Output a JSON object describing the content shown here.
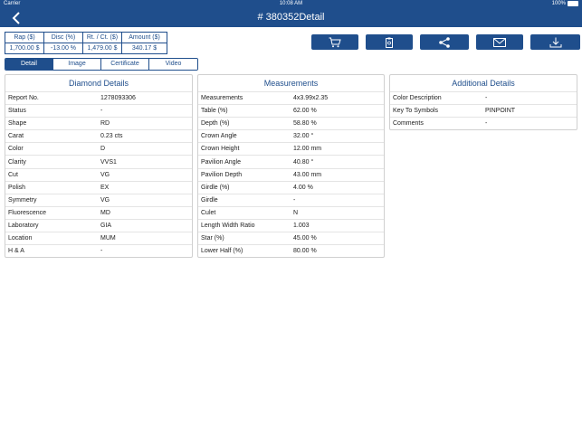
{
  "status_bar": {
    "carrier": "Carrier",
    "time": "10:08 AM",
    "battery": "100%"
  },
  "nav": {
    "title": "# 380352Detail"
  },
  "price": {
    "headers": [
      "Rap ($)",
      "Disc (%)",
      "Rt. / Ct. ($)",
      "Amount ($)"
    ],
    "values": [
      "1,700.00 $",
      "-13.00 %",
      "1,479.00 $",
      "340.17 $"
    ]
  },
  "actions": [
    "cart-icon",
    "clipboard-icon",
    "share-icon",
    "mail-icon",
    "download-icon"
  ],
  "tabs": [
    "Detail",
    "Image",
    "Certificate",
    "Video"
  ],
  "active_tab": "Detail",
  "diamond_details": {
    "title": "Diamond Details",
    "rows": [
      {
        "k": "Report No.",
        "v": "1278093306"
      },
      {
        "k": "Status",
        "v": "-"
      },
      {
        "k": "Shape",
        "v": "RD"
      },
      {
        "k": "Carat",
        "v": "0.23 cts"
      },
      {
        "k": "Color",
        "v": "D"
      },
      {
        "k": "Clarity",
        "v": "VVS1"
      },
      {
        "k": "Cut",
        "v": "VG"
      },
      {
        "k": "Polish",
        "v": "EX"
      },
      {
        "k": "Symmetry",
        "v": "VG"
      },
      {
        "k": "Fluorescence",
        "v": "MD"
      },
      {
        "k": "Laboratory",
        "v": "GIA"
      },
      {
        "k": "Location",
        "v": "MUM"
      },
      {
        "k": "H & A",
        "v": "-"
      }
    ]
  },
  "measurements": {
    "title": "Measurements",
    "rows": [
      {
        "k": "Measurements",
        "v": "4x3.99x2.35"
      },
      {
        "k": "Table (%)",
        "v": "62.00 %"
      },
      {
        "k": "Depth (%)",
        "v": "58.80 %"
      },
      {
        "k": "Crown Angle",
        "v": "32.00 °"
      },
      {
        "k": "Crown Height",
        "v": "12.00 mm"
      },
      {
        "k": "Pavilion Angle",
        "v": "40.80 °"
      },
      {
        "k": "Pavilion Depth",
        "v": "43.00 mm"
      },
      {
        "k": "Girdle (%)",
        "v": "4.00 %"
      },
      {
        "k": "Girdle",
        "v": "-"
      },
      {
        "k": "Culet",
        "v": "N"
      },
      {
        "k": "Length Width Ratio",
        "v": "1.003"
      },
      {
        "k": "Star (%)",
        "v": "45.00 %"
      },
      {
        "k": "Lower Half (%)",
        "v": "80.00 %"
      }
    ]
  },
  "additional_details": {
    "title": "Additional Details",
    "rows": [
      {
        "k": "Color Description",
        "v": "-"
      },
      {
        "k": "Key To Symbols",
        "v": "PINPOINT"
      },
      {
        "k": "Comments",
        "v": "-"
      }
    ]
  },
  "colors": {
    "primary": "#1f4e8c",
    "border": "#d0d0d0"
  }
}
